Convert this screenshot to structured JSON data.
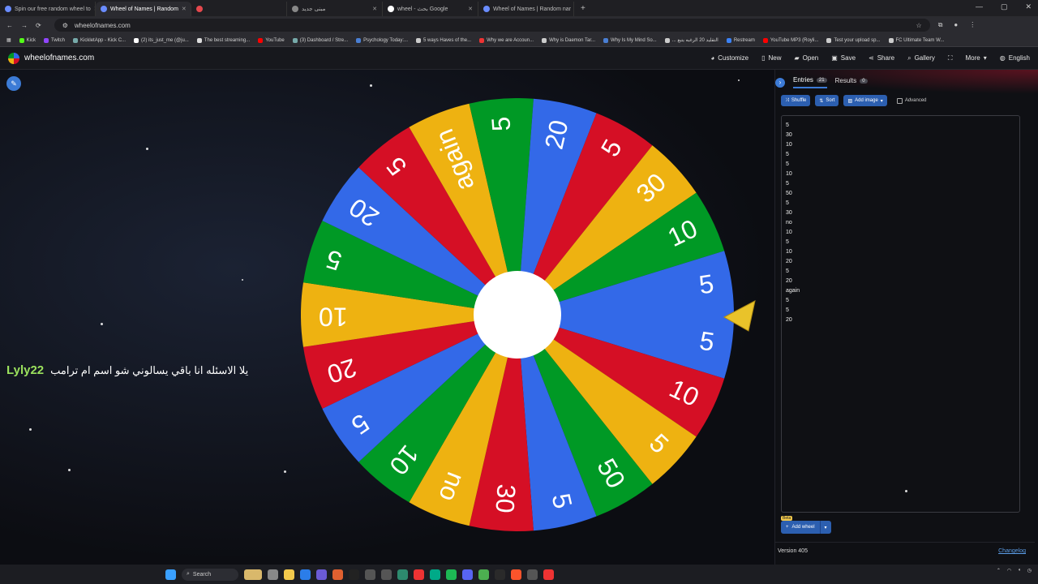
{
  "browser": {
    "tabs": [
      {
        "title": "Spin our free random wheel to"
      },
      {
        "title": "Wheel of Names | Random",
        "active": true
      },
      {
        "title": ""
      },
      {
        "title": "مبنى جديد"
      },
      {
        "title": "wheel - بحث Google"
      },
      {
        "title": "Wheel of Names | Random nar"
      }
    ],
    "url": "wheelofnames.com",
    "bookmarks": [
      "Kick",
      "Twitch",
      "KickletApp - Kick C...",
      "(2) its_just_me (@ju...",
      "The best streaming...",
      "YouTube",
      "(3) Dashboard / Stre...",
      "Psychology Today:...",
      "5 ways Haves of the...",
      "Why we are Accoun...",
      "Why is Daemon Tar...",
      "Why Is My Mind So...",
      "... التقليد 20 الرغبه يتبع",
      "Restream",
      "YouTube MP3 (Royli...",
      "Test your upload sp...",
      "FC Ultimate Team W..."
    ]
  },
  "header": {
    "site_name": "wheelofnames.com",
    "menu": [
      {
        "icon": "palette-icon",
        "label": "Customize"
      },
      {
        "icon": "file-icon",
        "label": "New"
      },
      {
        "icon": "folder-icon",
        "label": "Open"
      },
      {
        "icon": "save-icon",
        "label": "Save"
      },
      {
        "icon": "share-icon",
        "label": "Share"
      },
      {
        "icon": "search-icon",
        "label": "Gallery"
      },
      {
        "icon": "fullscreen-icon",
        "label": ""
      },
      {
        "icon": "chevron-down-icon",
        "label": "More"
      },
      {
        "icon": "globe-icon",
        "label": "English"
      }
    ]
  },
  "stage": {
    "chat_user": "Lyly22",
    "chat_message": "يلا الاسئله انا باقي يسالوني شو اسم ام ترامب"
  },
  "wheel": {
    "colors": [
      "#3369e8",
      "#d50f25",
      "#eeb211",
      "#009925"
    ],
    "segments": [
      "5",
      "10",
      "5",
      "50",
      "5",
      "30",
      "no",
      "10",
      "5",
      "20",
      "10",
      "5",
      "20",
      "5",
      "again",
      "5",
      "20",
      "5",
      "30",
      "10",
      "5"
    ]
  },
  "sidebar": {
    "entries_tab": "Entries",
    "entries_count": "21",
    "results_tab": "Results",
    "results_count": "0",
    "shuffle": "Shuffle",
    "sort": "Sort",
    "add_image": "Add image",
    "advanced": "Advanced",
    "entries": [
      "5",
      "30",
      "10",
      "5",
      "5",
      "10",
      "5",
      "50",
      "5",
      "30",
      "no",
      "10",
      "5",
      "10",
      "20",
      "5",
      "20",
      "again",
      "5",
      "5",
      "20"
    ],
    "beta": "Beta",
    "add_wheel": "Add wheel",
    "version": "Version 405",
    "changelog": "Changelog"
  },
  "taskbar": {
    "search_label": "Search"
  }
}
